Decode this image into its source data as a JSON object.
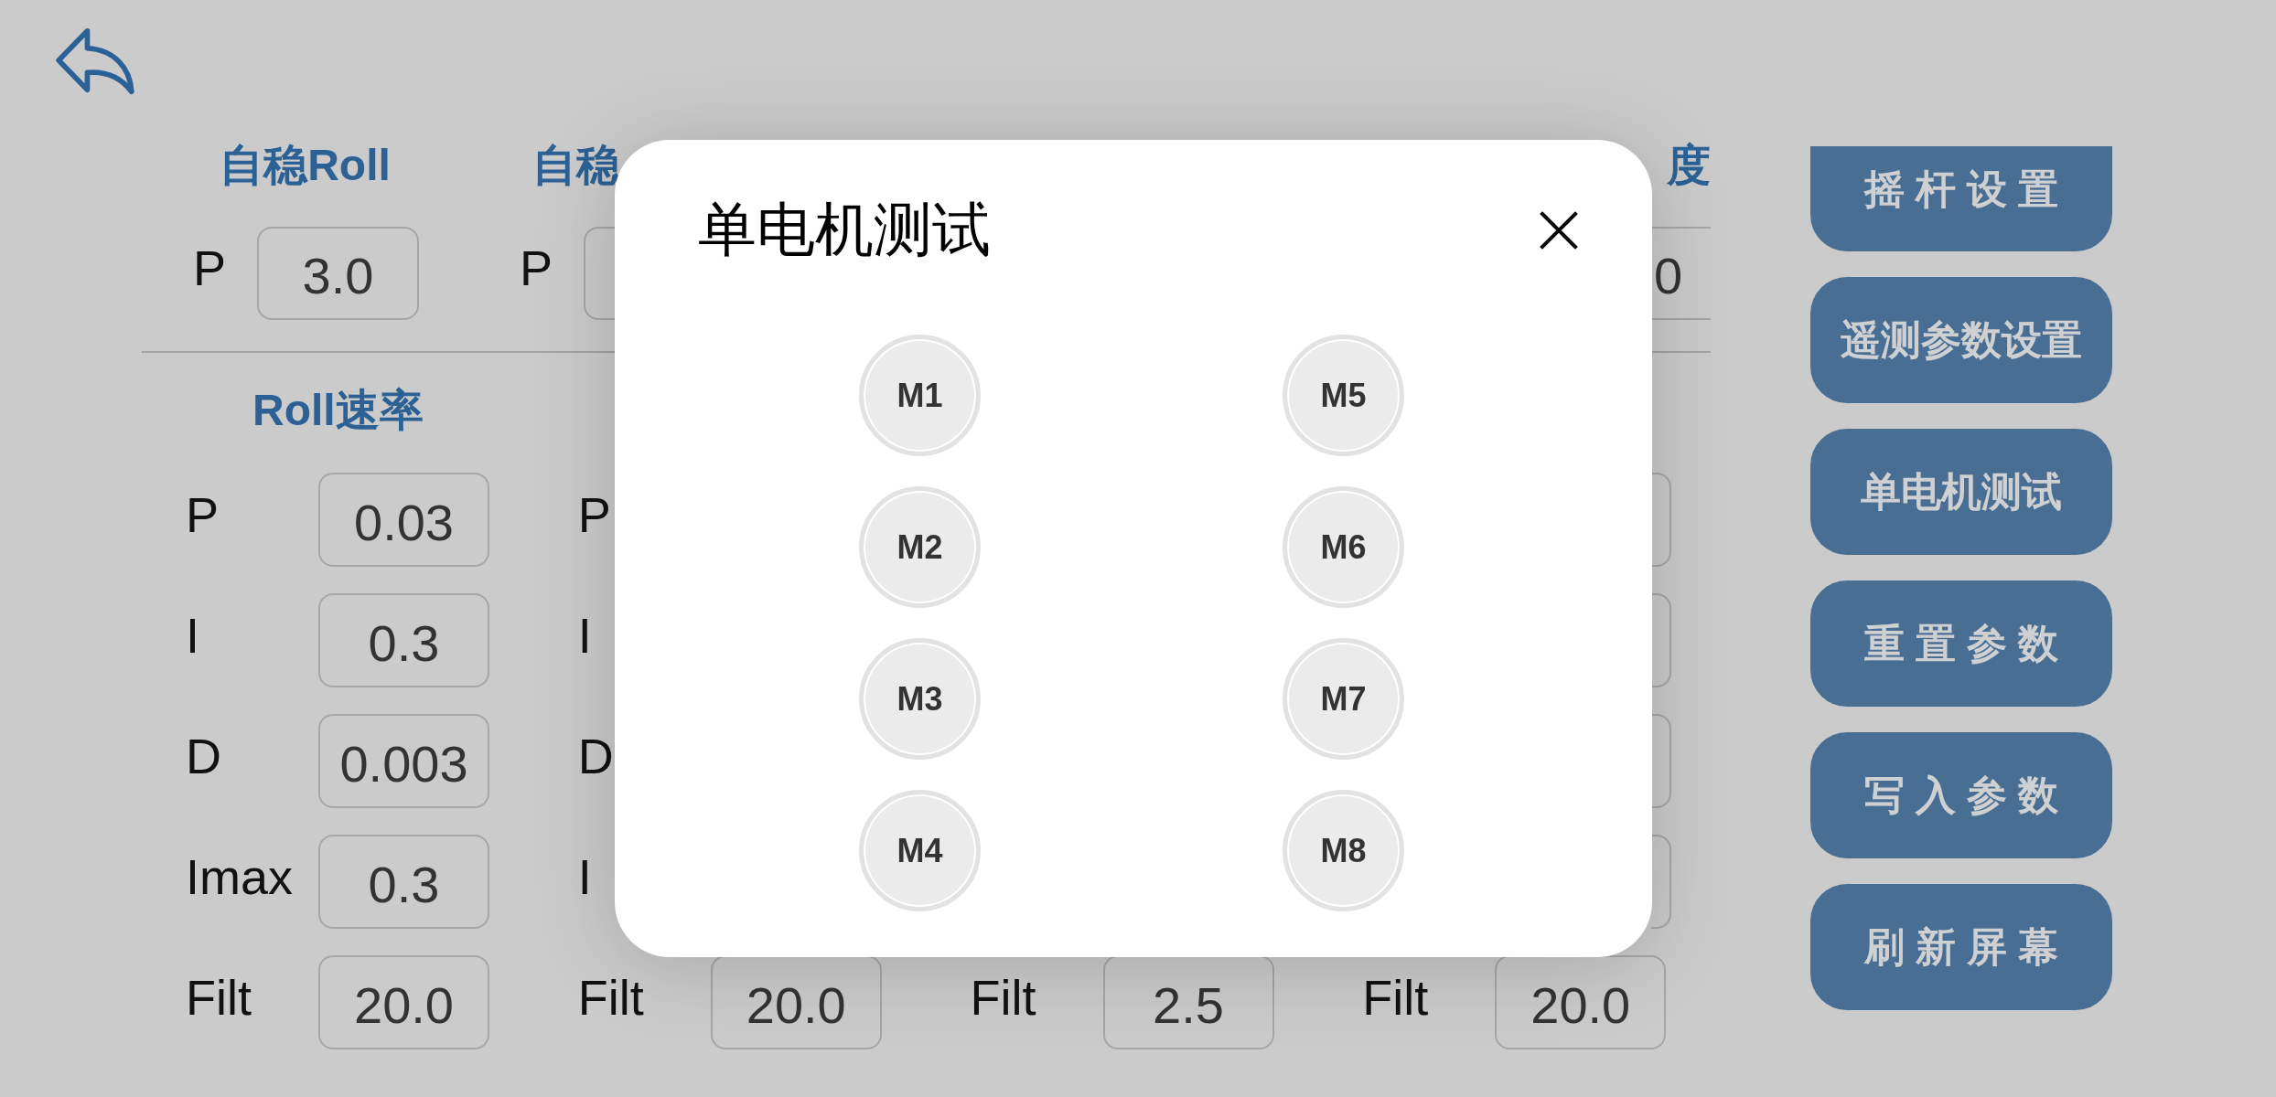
{
  "stabilize_section": {
    "columns": [
      {
        "header": "自稳Roll",
        "fields": [
          {
            "kind": "whole",
            "label": "P",
            "value": "3.0"
          }
        ]
      },
      {
        "header": "自稳",
        "fields": [
          {
            "kind": "left_end",
            "label": "P"
          }
        ]
      },
      {
        "header": "度",
        "fields": [
          {
            "kind": "middle",
            "value": "0"
          }
        ]
      }
    ]
  },
  "rate_section": {
    "columns": [
      {
        "header": "Roll速率",
        "fields": [
          {
            "kind": "whole",
            "label": "P",
            "value": "0.03"
          },
          {
            "kind": "whole",
            "label": "I",
            "value": "0.3"
          },
          {
            "kind": "whole",
            "label": "D",
            "value": "0.003"
          },
          {
            "kind": "whole",
            "label": "Imax",
            "value": "0.3"
          },
          {
            "kind": "whole",
            "label": "Filt",
            "value": "20.0"
          }
        ]
      },
      {
        "fields": [
          {
            "kind": "label",
            "label": "P"
          },
          {
            "kind": "label",
            "label": "I"
          },
          {
            "kind": "label",
            "label": "D"
          },
          {
            "kind": "label",
            "label": "I"
          },
          {
            "kind": "whole",
            "label": "Filt",
            "value": "20.0"
          }
        ]
      },
      {
        "fields": [
          {
            "kind": "whole",
            "label": "Filt",
            "value": "2.5"
          }
        ]
      },
      {
        "fields": [
          {
            "kind": "right_end"
          },
          {
            "kind": "right_end"
          },
          {
            "kind": "right_end"
          },
          {
            "kind": "right_end"
          },
          {
            "kind": "whole",
            "label": "Filt",
            "value": "20.0"
          }
        ]
      }
    ]
  },
  "side_buttons": [
    "摇 杆 设 置",
    "遥测参数设置",
    "单电机测试",
    "重 置 参 数",
    "写 入 参 数",
    "刷 新 屏 幕"
  ],
  "dialog": {
    "title": "单电机测试",
    "motors": [
      "M1",
      "M2",
      "M3",
      "M4",
      "M5",
      "M6",
      "M7",
      "M8"
    ]
  }
}
